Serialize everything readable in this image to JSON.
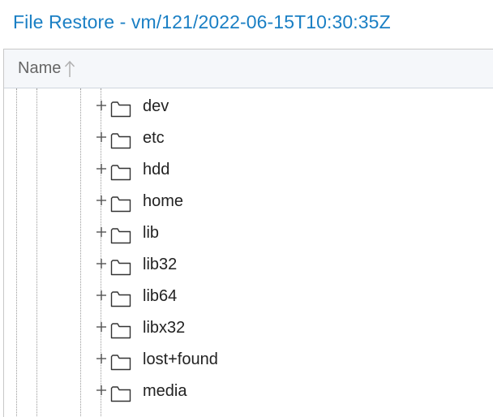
{
  "window": {
    "title": "File Restore - vm/121/2022-06-15T10:30:35Z"
  },
  "grid": {
    "columns": [
      {
        "label": "Name",
        "sort": "ascending"
      }
    ],
    "rows": [
      {
        "label": "dev",
        "type": "folder",
        "expandable": true
      },
      {
        "label": "etc",
        "type": "folder",
        "expandable": true
      },
      {
        "label": "hdd",
        "type": "folder",
        "expandable": true
      },
      {
        "label": "home",
        "type": "folder",
        "expandable": true
      },
      {
        "label": "lib",
        "type": "folder",
        "expandable": true
      },
      {
        "label": "lib32",
        "type": "folder",
        "expandable": true
      },
      {
        "label": "lib64",
        "type": "folder",
        "expandable": true
      },
      {
        "label": "libx32",
        "type": "folder",
        "expandable": true
      },
      {
        "label": "lost+found",
        "type": "folder",
        "expandable": true
      },
      {
        "label": "media",
        "type": "folder",
        "expandable": true
      }
    ]
  },
  "icons": {
    "sort": "arrow-up-icon",
    "expander": "plus-icon",
    "folder": "folder-icon"
  },
  "colors": {
    "title": "#1a7fc4",
    "header_bg": "#f5f7fa",
    "text": "#222222"
  }
}
